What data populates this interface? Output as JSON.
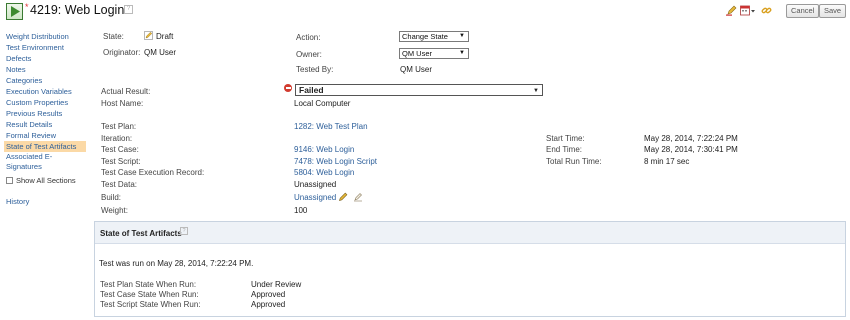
{
  "header": {
    "dirty_marker": "*",
    "title": "4219: Web Login",
    "help_glyph": "?",
    "cancel_label": "Cancel",
    "save_label": "Save"
  },
  "sidebar": {
    "items": [
      {
        "label": "Weight Distribution"
      },
      {
        "label": "Test Environment"
      },
      {
        "label": "Defects"
      },
      {
        "label": "Notes"
      },
      {
        "label": "Categories"
      },
      {
        "label": "Execution Variables"
      },
      {
        "label": "Custom Properties"
      },
      {
        "label": "Previous Results"
      },
      {
        "label": "Result Details"
      },
      {
        "label": "Formal Review"
      },
      {
        "label": "State of Test Artifacts",
        "active": true
      },
      {
        "label": "Associated E-Signatures"
      }
    ],
    "show_all_label": "Show All Sections",
    "history_label": "History"
  },
  "summary": {
    "state_label": "State:",
    "state_value": "Draft",
    "originator_label": "Originator:",
    "originator_value": "QM User",
    "action_label": "Action:",
    "action_value": "Change State",
    "owner_label": "Owner:",
    "owner_value": "QM User",
    "tested_by_label": "Tested By:",
    "tested_by_value": "QM User"
  },
  "result": {
    "actual_result_label": "Actual Result:",
    "actual_result_value": "Failed",
    "host_name_label": "Host Name:",
    "host_name_value": "Local Computer"
  },
  "details": {
    "test_plan_label": "Test Plan:",
    "test_plan_value": "1282: Web Test Plan",
    "iteration_label": "Iteration:",
    "test_case_label": "Test Case:",
    "test_case_value": "9146: Web Login",
    "test_script_label": "Test Script:",
    "test_script_value": "7478: Web Login Script",
    "tcer_label": "Test Case Execution Record:",
    "tcer_value": "5804: Web Login",
    "test_data_label": "Test Data:",
    "test_data_value": "Unassigned",
    "build_label": "Build:",
    "build_value": "Unassigned",
    "weight_label": "Weight:",
    "weight_value": "100",
    "start_time_label": "Start Time:",
    "start_time_value": "May 28, 2014, 7:22:24 PM",
    "end_time_label": "End Time:",
    "end_time_value": "May 28, 2014, 7:30:41 PM",
    "total_run_time_label": "Total Run Time:",
    "total_run_time_value": "8 min 17 sec"
  },
  "artifacts": {
    "title": "State of Test Artifacts",
    "run_text": "Test was run on May 28, 2014, 7:22:24 PM.",
    "rows": [
      {
        "label": "Test Plan State When Run:",
        "value": "Under Review"
      },
      {
        "label": "Test Case State When Run:",
        "value": "Approved"
      },
      {
        "label": "Test Script State When Run:",
        "value": "Approved"
      }
    ]
  },
  "colors": {
    "link": "#2d5f9a",
    "active_nav": "#fbd9a6",
    "failed": "#d23b2f"
  }
}
